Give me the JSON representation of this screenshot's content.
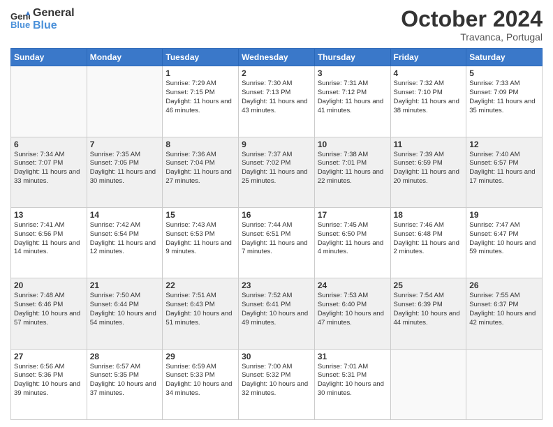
{
  "logo": {
    "line1": "General",
    "line2": "Blue"
  },
  "header": {
    "month": "October 2024",
    "location": "Travanca, Portugal"
  },
  "days_of_week": [
    "Sunday",
    "Monday",
    "Tuesday",
    "Wednesday",
    "Thursday",
    "Friday",
    "Saturday"
  ],
  "weeks": [
    [
      {
        "day": "",
        "info": ""
      },
      {
        "day": "",
        "info": ""
      },
      {
        "day": "1",
        "info": "Sunrise: 7:29 AM\nSunset: 7:15 PM\nDaylight: 11 hours and 46 minutes."
      },
      {
        "day": "2",
        "info": "Sunrise: 7:30 AM\nSunset: 7:13 PM\nDaylight: 11 hours and 43 minutes."
      },
      {
        "day": "3",
        "info": "Sunrise: 7:31 AM\nSunset: 7:12 PM\nDaylight: 11 hours and 41 minutes."
      },
      {
        "day": "4",
        "info": "Sunrise: 7:32 AM\nSunset: 7:10 PM\nDaylight: 11 hours and 38 minutes."
      },
      {
        "day": "5",
        "info": "Sunrise: 7:33 AM\nSunset: 7:09 PM\nDaylight: 11 hours and 35 minutes."
      }
    ],
    [
      {
        "day": "6",
        "info": "Sunrise: 7:34 AM\nSunset: 7:07 PM\nDaylight: 11 hours and 33 minutes."
      },
      {
        "day": "7",
        "info": "Sunrise: 7:35 AM\nSunset: 7:05 PM\nDaylight: 11 hours and 30 minutes."
      },
      {
        "day": "8",
        "info": "Sunrise: 7:36 AM\nSunset: 7:04 PM\nDaylight: 11 hours and 27 minutes."
      },
      {
        "day": "9",
        "info": "Sunrise: 7:37 AM\nSunset: 7:02 PM\nDaylight: 11 hours and 25 minutes."
      },
      {
        "day": "10",
        "info": "Sunrise: 7:38 AM\nSunset: 7:01 PM\nDaylight: 11 hours and 22 minutes."
      },
      {
        "day": "11",
        "info": "Sunrise: 7:39 AM\nSunset: 6:59 PM\nDaylight: 11 hours and 20 minutes."
      },
      {
        "day": "12",
        "info": "Sunrise: 7:40 AM\nSunset: 6:57 PM\nDaylight: 11 hours and 17 minutes."
      }
    ],
    [
      {
        "day": "13",
        "info": "Sunrise: 7:41 AM\nSunset: 6:56 PM\nDaylight: 11 hours and 14 minutes."
      },
      {
        "day": "14",
        "info": "Sunrise: 7:42 AM\nSunset: 6:54 PM\nDaylight: 11 hours and 12 minutes."
      },
      {
        "day": "15",
        "info": "Sunrise: 7:43 AM\nSunset: 6:53 PM\nDaylight: 11 hours and 9 minutes."
      },
      {
        "day": "16",
        "info": "Sunrise: 7:44 AM\nSunset: 6:51 PM\nDaylight: 11 hours and 7 minutes."
      },
      {
        "day": "17",
        "info": "Sunrise: 7:45 AM\nSunset: 6:50 PM\nDaylight: 11 hours and 4 minutes."
      },
      {
        "day": "18",
        "info": "Sunrise: 7:46 AM\nSunset: 6:48 PM\nDaylight: 11 hours and 2 minutes."
      },
      {
        "day": "19",
        "info": "Sunrise: 7:47 AM\nSunset: 6:47 PM\nDaylight: 10 hours and 59 minutes."
      }
    ],
    [
      {
        "day": "20",
        "info": "Sunrise: 7:48 AM\nSunset: 6:46 PM\nDaylight: 10 hours and 57 minutes."
      },
      {
        "day": "21",
        "info": "Sunrise: 7:50 AM\nSunset: 6:44 PM\nDaylight: 10 hours and 54 minutes."
      },
      {
        "day": "22",
        "info": "Sunrise: 7:51 AM\nSunset: 6:43 PM\nDaylight: 10 hours and 51 minutes."
      },
      {
        "day": "23",
        "info": "Sunrise: 7:52 AM\nSunset: 6:41 PM\nDaylight: 10 hours and 49 minutes."
      },
      {
        "day": "24",
        "info": "Sunrise: 7:53 AM\nSunset: 6:40 PM\nDaylight: 10 hours and 47 minutes."
      },
      {
        "day": "25",
        "info": "Sunrise: 7:54 AM\nSunset: 6:39 PM\nDaylight: 10 hours and 44 minutes."
      },
      {
        "day": "26",
        "info": "Sunrise: 7:55 AM\nSunset: 6:37 PM\nDaylight: 10 hours and 42 minutes."
      }
    ],
    [
      {
        "day": "27",
        "info": "Sunrise: 6:56 AM\nSunset: 5:36 PM\nDaylight: 10 hours and 39 minutes."
      },
      {
        "day": "28",
        "info": "Sunrise: 6:57 AM\nSunset: 5:35 PM\nDaylight: 10 hours and 37 minutes."
      },
      {
        "day": "29",
        "info": "Sunrise: 6:59 AM\nSunset: 5:33 PM\nDaylight: 10 hours and 34 minutes."
      },
      {
        "day": "30",
        "info": "Sunrise: 7:00 AM\nSunset: 5:32 PM\nDaylight: 10 hours and 32 minutes."
      },
      {
        "day": "31",
        "info": "Sunrise: 7:01 AM\nSunset: 5:31 PM\nDaylight: 10 hours and 30 minutes."
      },
      {
        "day": "",
        "info": ""
      },
      {
        "day": "",
        "info": ""
      }
    ]
  ]
}
